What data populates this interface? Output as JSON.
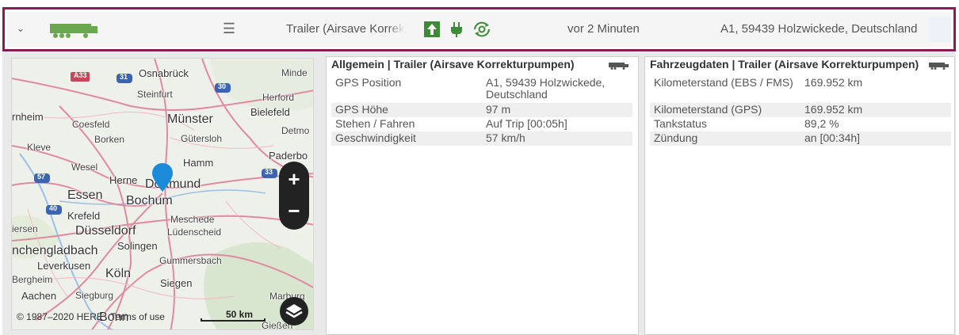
{
  "header": {
    "vehicle_name": "Trailer (Airsave Korrekturpumpen)",
    "last_seen": "vor 2 Minuten",
    "address": "A1, 59439 Holzwickede, Deutschland",
    "icons": {
      "expand": "chevron-down-icon",
      "vehicle": "trailer-truck-icon",
      "menu": "hamburger-menu-icon",
      "status_1": "arrow-up-box-icon",
      "status_2": "power-plug-icon",
      "status_3": "sync-cog-icon"
    },
    "colors": {
      "border": "#8b1a56",
      "accent_green": "#6aa84f"
    }
  },
  "map": {
    "cities": [
      "Osnabrück",
      "Minde",
      "Steinfurt",
      "Herford",
      "Bielefeld",
      "rnheim",
      "Coesfeld",
      "Münster",
      "Detmo",
      "Borken",
      "Gütersloh",
      "Kleve",
      "Paderbo",
      "Wesel",
      "Hamm",
      "Herne",
      "Dortmund",
      "Essen",
      "Bochum",
      "Krefeld",
      "Meschede",
      "iersen",
      "Düsseldorf",
      "Lüdenscheid",
      "nchengladbach",
      "Solingen",
      "Gummersbach",
      "Leverkusen",
      "Köln",
      "Bergheim",
      "Siegen",
      "Aachen",
      "Siegburg",
      "Bonn",
      "Marburg",
      "Gießen"
    ],
    "road_badges": [
      "A33",
      "31",
      "30",
      "33",
      "57",
      "40"
    ],
    "zoom_in": "+",
    "zoom_out": "−",
    "attribution": "© 1987–2020 HERE",
    "terms": "Terms of use",
    "scale_label": "50 km",
    "icons": {
      "pin": "map-pin-icon",
      "layers": "layers-icon"
    }
  },
  "panel_general": {
    "title": "Allgemein | Trailer (Airsave Korrekturpumpen)",
    "rows": [
      {
        "label": "GPS Position",
        "value": "A1, 59439 Holzwickede, Deutschland"
      },
      {
        "label": "GPS Höhe",
        "value": "97 m"
      },
      {
        "label": "Stehen / Fahren",
        "value": "Auf Trip [00:05h]"
      },
      {
        "label": "Geschwindigkeit",
        "value": "57 km/h"
      }
    ]
  },
  "panel_vehicle": {
    "title": "Fahrzeugdaten | Trailer (Airsave Korrekturpumpen)",
    "rows": [
      {
        "label": "Kilometerstand (EBS / FMS)",
        "value": "169.952 km"
      },
      {
        "label": "Kilometerstand (GPS)",
        "value": "169.952 km"
      },
      {
        "label": "Tankstatus",
        "value": "89,2 %"
      },
      {
        "label": "Zündung",
        "value": "an [00:34h]"
      }
    ]
  }
}
